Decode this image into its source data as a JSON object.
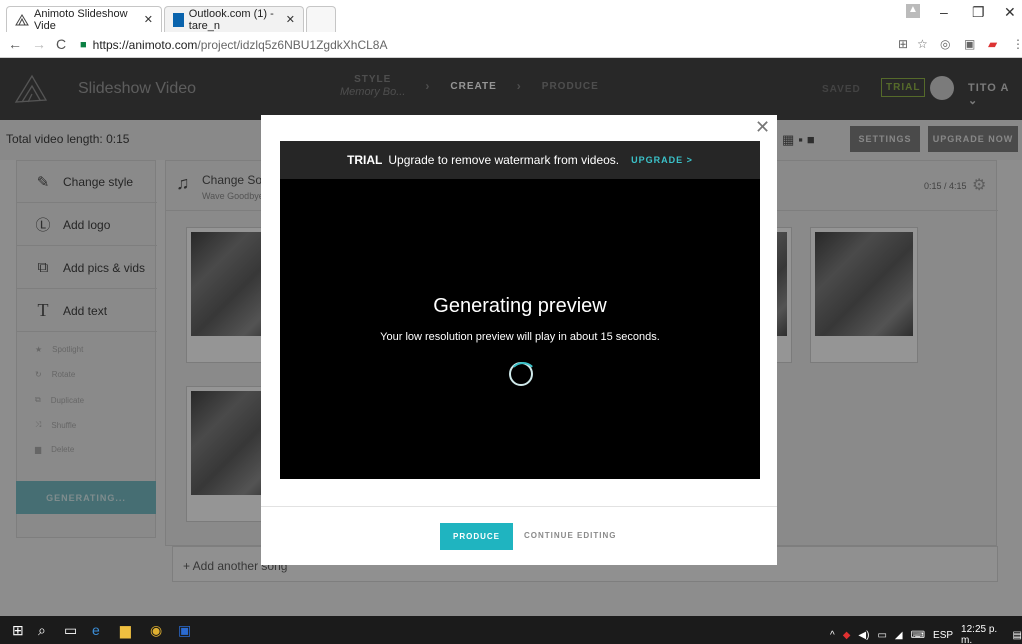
{
  "browser": {
    "tabs": [
      {
        "label": "Animoto Slideshow Vide"
      },
      {
        "label": "Outlook.com (1) - tare_n"
      }
    ],
    "url_host": "https://animoto.com",
    "url_path": "/project/idzlq5z6NBU1ZgdkXhCL8A"
  },
  "header": {
    "title": "Slideshow Video",
    "step_style_label": "STYLE",
    "step_style_value": "Memory Bo...",
    "step_create": "CREATE",
    "step_produce": "PRODUCE",
    "saved": "SAVED",
    "trial": "TRIAL",
    "user": "TITO A"
  },
  "toolbar": {
    "video_length": "Total video length: 0:15",
    "settings": "SETTINGS",
    "upgrade_now": "UPGRADE NOW"
  },
  "sidebar": {
    "items": [
      {
        "label": "Change style"
      },
      {
        "label": "Add logo"
      },
      {
        "label": "Add pics & vids"
      },
      {
        "label": "Add text"
      }
    ],
    "small_items": [
      {
        "label": "Spotlight"
      },
      {
        "label": "Rotate"
      },
      {
        "label": "Duplicate"
      },
      {
        "label": "Shuffle"
      },
      {
        "label": "Delete"
      }
    ],
    "generating": "GENERATING..."
  },
  "song": {
    "title": "Change Sor",
    "subtitle": "Wave Goodbye",
    "duration": "0:15 / 4:15",
    "add_another": "+ Add another song"
  },
  "modal": {
    "trial_word": "TRIAL",
    "trial_text": "Upgrade to remove watermark from videos.",
    "upgrade_link": "UPGRADE >",
    "title": "Generating preview",
    "text": "Your low resolution preview will play in about 15 seconds.",
    "produce": "PRODUCE",
    "continue": "CONTINUE EDITING"
  },
  "taskbar": {
    "lang": "ESP",
    "time": "12:25 p. m."
  }
}
